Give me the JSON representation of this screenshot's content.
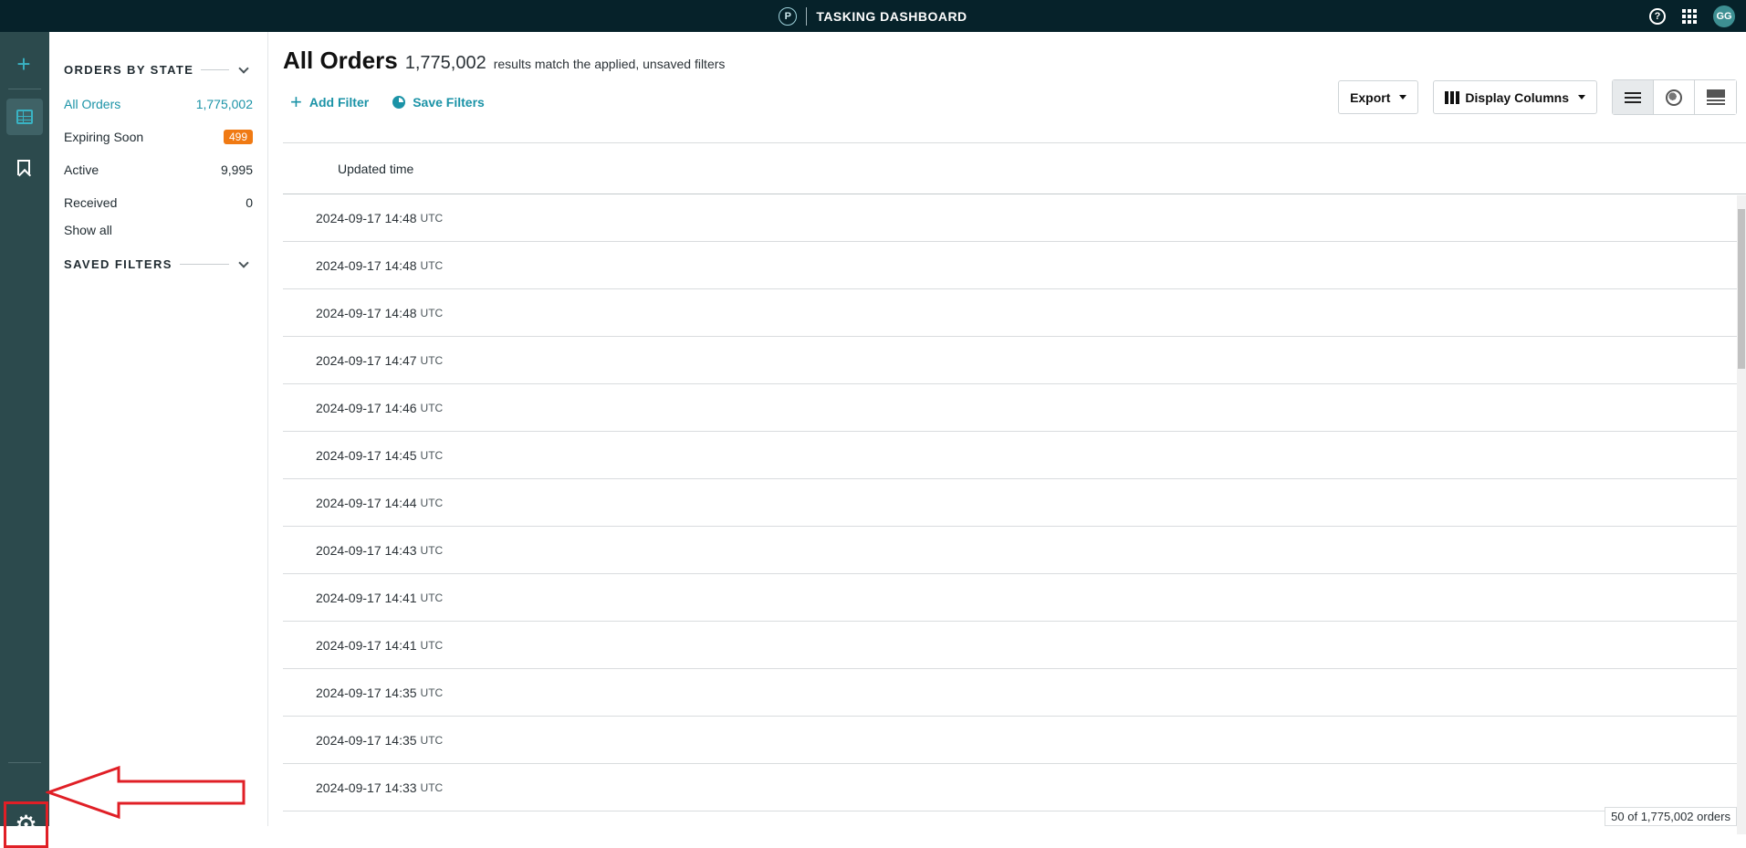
{
  "header": {
    "logo_letter": "P",
    "title": "TASKING DASHBOARD",
    "help_glyph": "?",
    "avatar_initials": "GG"
  },
  "rail": {
    "icons": [
      "plus-icon",
      "orders-grid-icon",
      "bookmark-icon",
      "gear-icon"
    ]
  },
  "sidebar": {
    "orders_by_state_title": "ORDERS BY STATE",
    "states": [
      {
        "label": "All Orders",
        "count": "1,775,002"
      },
      {
        "label": "Expiring Soon",
        "count": "499"
      },
      {
        "label": "Active",
        "count": "9,995"
      },
      {
        "label": "Received",
        "count": "0"
      }
    ],
    "show_all": "Show all",
    "saved_filters_title": "SAVED FILTERS"
  },
  "main": {
    "title": "All Orders",
    "result_count": "1,775,002",
    "result_text": "results match the applied, unsaved filters",
    "add_filter": "Add Filter",
    "save_filters": "Save Filters",
    "export_label": "Export",
    "display_columns_label": "Display Columns",
    "column_header": "Updated time",
    "rows": [
      {
        "time": "2024-09-17 14:48",
        "tz": "UTC"
      },
      {
        "time": "2024-09-17 14:48",
        "tz": "UTC"
      },
      {
        "time": "2024-09-17 14:48",
        "tz": "UTC"
      },
      {
        "time": "2024-09-17 14:47",
        "tz": "UTC"
      },
      {
        "time": "2024-09-17 14:46",
        "tz": "UTC"
      },
      {
        "time": "2024-09-17 14:45",
        "tz": "UTC"
      },
      {
        "time": "2024-09-17 14:44",
        "tz": "UTC"
      },
      {
        "time": "2024-09-17 14:43",
        "tz": "UTC"
      },
      {
        "time": "2024-09-17 14:41",
        "tz": "UTC"
      },
      {
        "time": "2024-09-17 14:41",
        "tz": "UTC"
      },
      {
        "time": "2024-09-17 14:35",
        "tz": "UTC"
      },
      {
        "time": "2024-09-17 14:35",
        "tz": "UTC"
      },
      {
        "time": "2024-09-17 14:33",
        "tz": "UTC"
      }
    ],
    "footer": "50 of 1,775,002 orders"
  },
  "colors": {
    "topbar": "#06222a",
    "rail": "#2c4a4d",
    "accent": "#1b93a7",
    "badge_orange": "#f07a13",
    "callout_red": "#e01f26"
  }
}
